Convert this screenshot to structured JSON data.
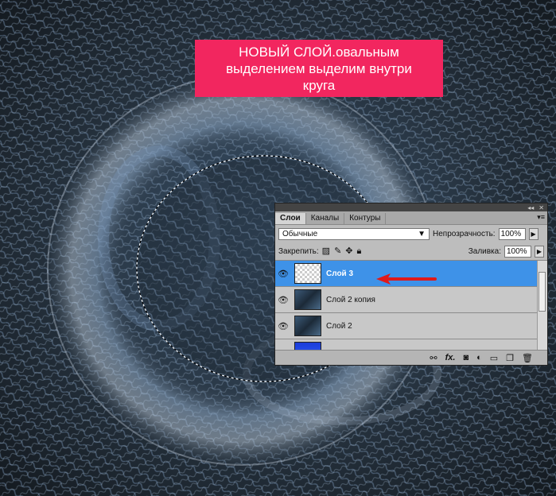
{
  "caption": {
    "line1": "НОВЫЙ СЛОЙ.овальным",
    "line2": "выделением выделим внутри",
    "line3": "круга"
  },
  "panel": {
    "tabs": [
      "Слои",
      "Каналы",
      "Контуры"
    ],
    "blend_mode": "Обычные",
    "opacity_label": "Непрозрачность:",
    "opacity_value": "100%",
    "lock_label": "Закрепить:",
    "fill_label": "Заливка:",
    "fill_value": "100%",
    "layers": [
      {
        "name": "Слой 3",
        "selected": true
      },
      {
        "name": "Слой 2 копия",
        "selected": false
      },
      {
        "name": "Слой 2",
        "selected": false
      },
      {
        "name": "",
        "selected": false
      }
    ],
    "icons": {
      "lock": [
        "lock-transparent-icon",
        "lock-paint-brush-icon",
        "lock-move-icon",
        "lock-all-icon"
      ],
      "bottom": [
        "link-icon",
        "fx-icon",
        "mask-icon",
        "adjustment-icon",
        "group-folder-icon",
        "new-layer-icon",
        "trash-icon"
      ]
    }
  },
  "colors": {
    "caption_bg": "#f2265f",
    "selected_layer": "#3e92e8",
    "annotation_arrow": "#e01a1a"
  }
}
